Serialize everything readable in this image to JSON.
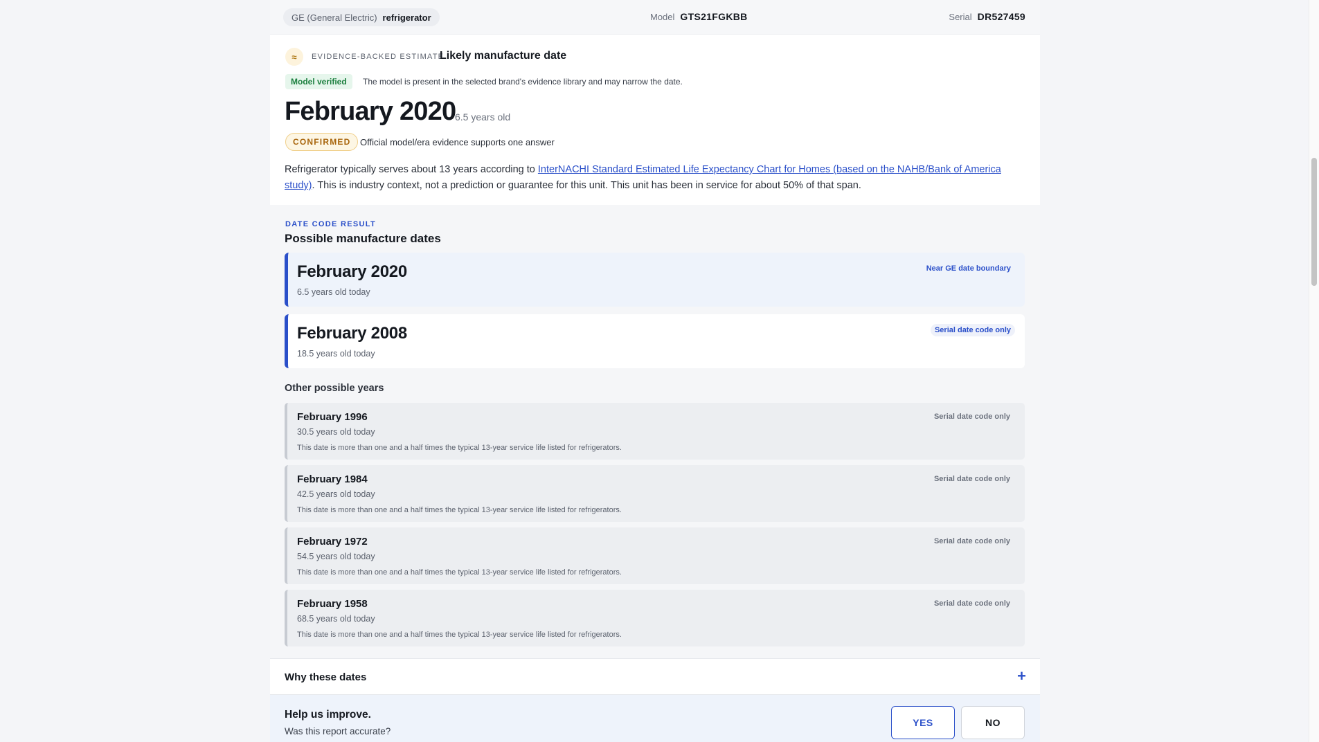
{
  "header": {
    "brand": "GE (General Electric)",
    "appliance": "refrigerator",
    "model_label": "Model",
    "model_value": "GTS21FGKBB",
    "serial_label": "Serial",
    "serial_value": "DR527459"
  },
  "estimate": {
    "icon_symbol": "≈",
    "eyebrow": "EVIDENCE-BACKED ESTIMATE",
    "title": "Likely manufacture date",
    "verified_badge": "Model verified",
    "verified_note": "The model is present in the selected brand's evidence library and may narrow the date.",
    "date": "February 2020",
    "age": "6.5 years old",
    "status_badge": "CONFIRMED",
    "status_note": "Official model/era evidence supports one answer",
    "context_prefix": "Refrigerator typically serves about 13 years according to ",
    "context_link": "InterNACHI Standard Estimated Life Expectancy Chart for Homes (based on the NAHB/Bank of America study)",
    "context_suffix": ". This is industry context, not a prediction or guarantee for this unit. This unit has been in service for about 50% of that span."
  },
  "date_code": {
    "eyebrow": "DATE CODE RESULT",
    "title": "Possible manufacture dates",
    "primary": [
      {
        "date": "February 2020",
        "age": "6.5 years old today",
        "tag": "Near GE date boundary"
      },
      {
        "date": "February 2008",
        "age": "18.5 years old today",
        "tag": "Serial date code only"
      }
    ],
    "other_title": "Other possible years",
    "others": [
      {
        "date": "February 1996",
        "age": "30.5 years old today",
        "note": "This date is more than one and a half times the typical 13-year service life listed for refrigerators.",
        "tag": "Serial date code only"
      },
      {
        "date": "February 1984",
        "age": "42.5 years old today",
        "note": "This date is more than one and a half times the typical 13-year service life listed for refrigerators.",
        "tag": "Serial date code only"
      },
      {
        "date": "February 1972",
        "age": "54.5 years old today",
        "note": "This date is more than one and a half times the typical 13-year service life listed for refrigerators.",
        "tag": "Serial date code only"
      },
      {
        "date": "February 1958",
        "age": "68.5 years old today",
        "note": "This date is more than one and a half times the typical 13-year service life listed for refrigerators.",
        "tag": "Serial date code only"
      }
    ]
  },
  "why": {
    "label": "Why these dates",
    "icon": "plus-icon",
    "symbol": "+"
  },
  "feedback": {
    "title": "Help us improve.",
    "question": "Was this report accurate?",
    "yes": "YES",
    "no": "NO"
  },
  "colors": {
    "accent": "#2a4fc9",
    "verified": "#1b7f3e",
    "confirmed": "#a8650c"
  }
}
